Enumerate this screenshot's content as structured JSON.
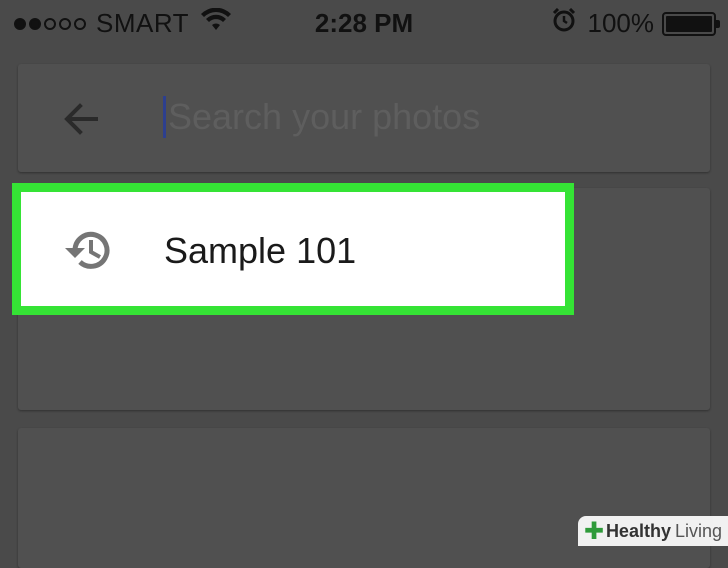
{
  "status_bar": {
    "carrier": "SMART",
    "time": "2:28 PM",
    "battery": "100%",
    "signal_icon": "signal-dots-icon",
    "wifi_icon": "wifi-icon",
    "alarm_icon": "alarm-clock-icon",
    "battery_icon": "battery-icon"
  },
  "search": {
    "placeholder": "Search your photos",
    "value": "",
    "back_icon": "arrow-left-icon"
  },
  "suggestions": [
    {
      "label": "Sample 101",
      "icon": "history-icon"
    }
  ],
  "highlight_color": "#35e335",
  "watermark": {
    "bold": "Healthy",
    "light": "Living"
  }
}
